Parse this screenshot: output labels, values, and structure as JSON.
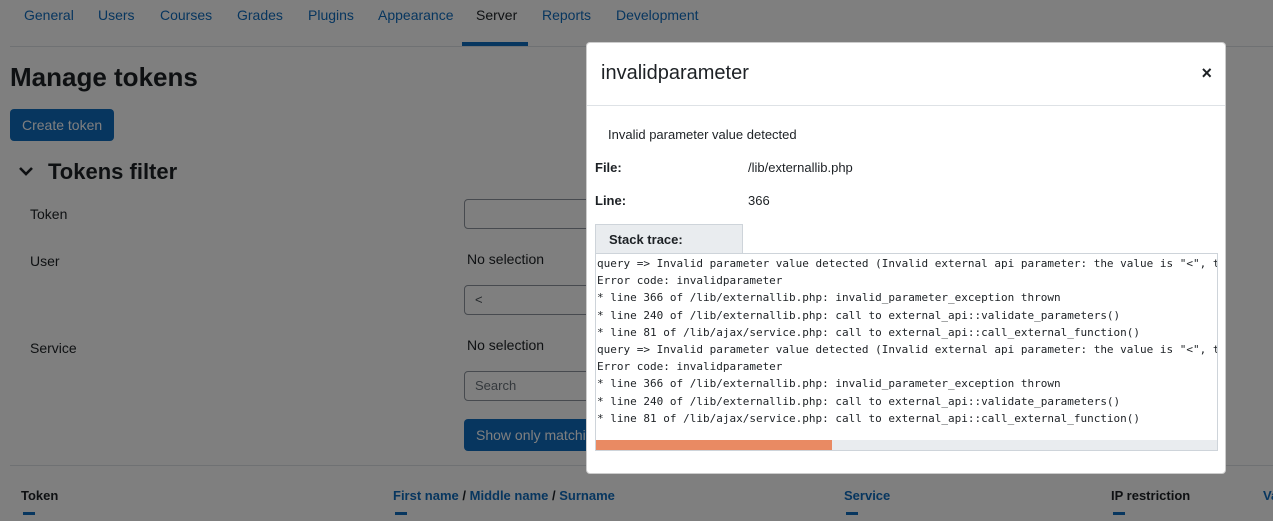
{
  "nav": {
    "tabs": [
      "General",
      "Users",
      "Courses",
      "Grades",
      "Plugins",
      "Appearance",
      "Server",
      "Reports",
      "Development"
    ],
    "active_tab": "Server"
  },
  "page": {
    "title": "Manage tokens",
    "create_button": "Create token"
  },
  "filter": {
    "heading": "Tokens filter",
    "token_label": "Token",
    "token_value": "",
    "user_label": "User",
    "user_selection": "No selection",
    "user_search_value": "<",
    "service_label": "Service",
    "service_selection": "No selection",
    "service_search_placeholder": "Search",
    "show_button": "Show only matching"
  },
  "table": {
    "headers": {
      "token": "Token",
      "first_name": "First name",
      "middle_name": "Middle name",
      "surname": "Surname",
      "name_separator": "/",
      "service": "Service",
      "ip_restriction": "IP restriction",
      "valid_until": "Va"
    }
  },
  "modal": {
    "title": "invalidparameter",
    "close_glyph": "×",
    "message": "Invalid parameter value detected",
    "file_label": "File:",
    "file_value": "/lib/externallib.php",
    "line_label": "Line:",
    "line_value": "366",
    "trace_tab": "Stack trace:",
    "trace_lines": [
      "query => Invalid parameter value detected (Invalid external api parameter: the value is \"<\", the server was expecting \"alphanumext\" type)",
      "Error code: invalidparameter",
      "* line 366 of /lib/externallib.php: invalid_parameter_exception thrown",
      "* line 240 of /lib/externallib.php: call to external_api::validate_parameters()",
      "* line 81 of /lib/ajax/service.php: call to external_api::call_external_function()",
      "query => Invalid parameter value detected (Invalid external api parameter: the value is \"<\", the server was expecting \"alphanumext\" type)",
      "Error code: invalidparameter",
      "* line 366 of /lib/externallib.php: invalid_parameter_exception thrown",
      "* line 240 of /lib/externallib.php: call to external_api::validate_parameters()",
      "* line 81 of /lib/ajax/service.php: call to external_api::call_external_function()"
    ]
  },
  "colors": {
    "accent": "#0f6cbf",
    "scroll_thumb": "#e98a63"
  }
}
